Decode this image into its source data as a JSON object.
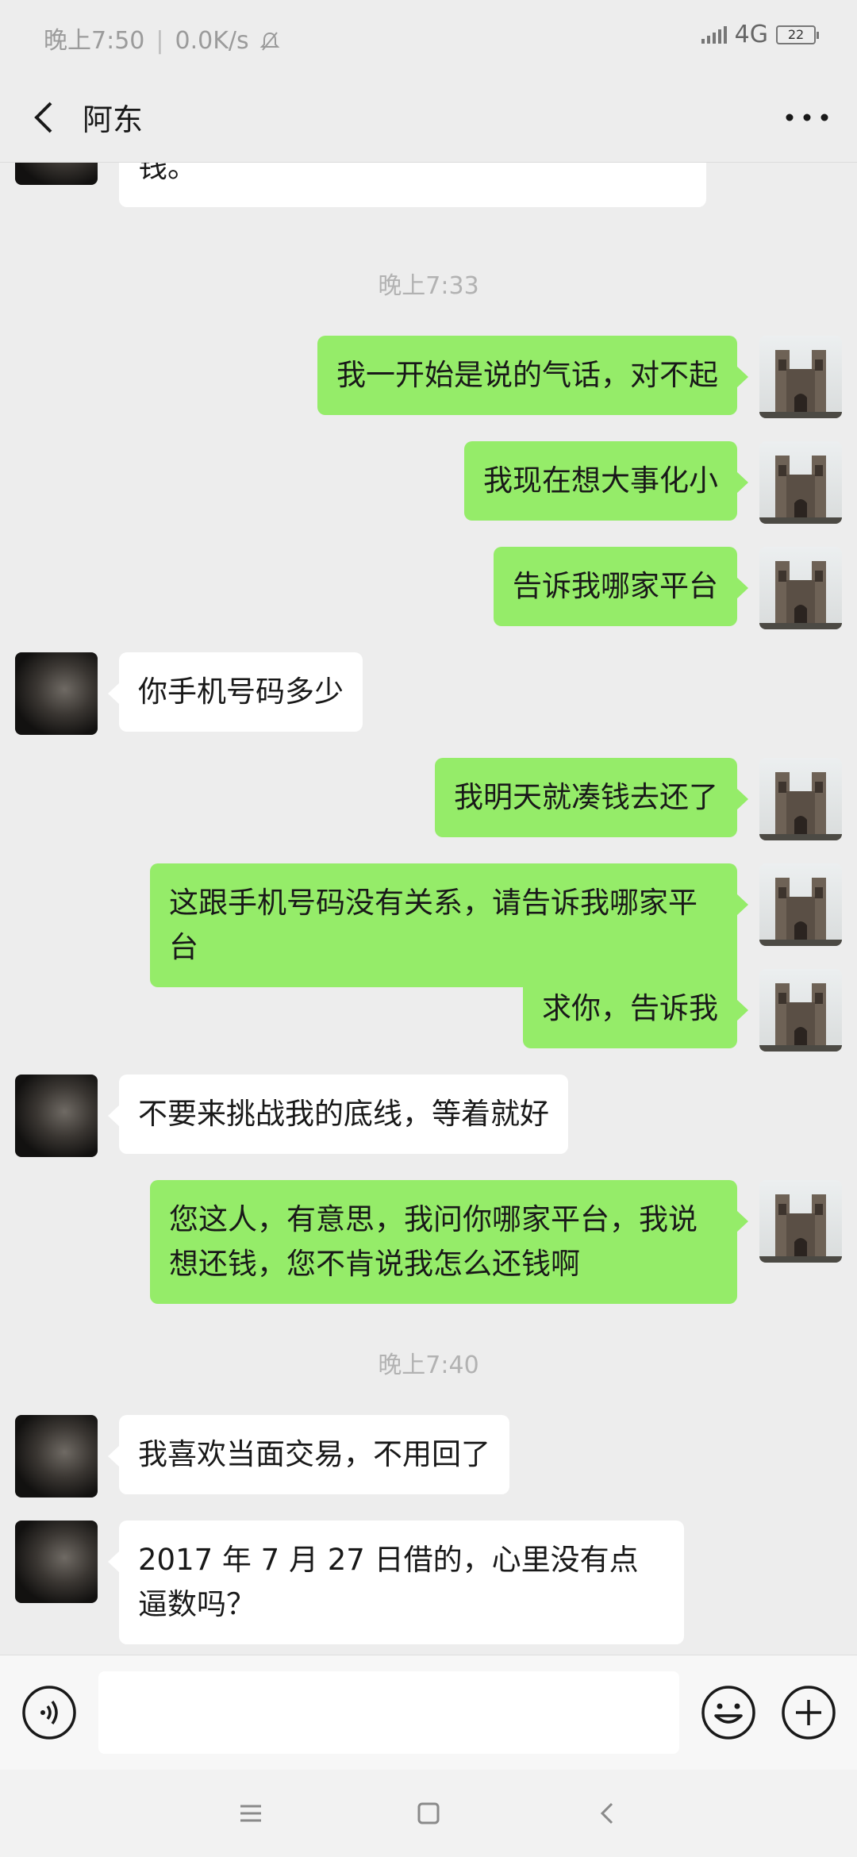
{
  "status": {
    "time": "晚上7:50",
    "speed": "0.0K/s",
    "network": "4G",
    "battery": "22"
  },
  "header": {
    "title": "阿东"
  },
  "messages": {
    "m0": "钱。",
    "t1": "晚上7:33",
    "m1": "我一开始是说的气话，对不起",
    "m2": "我现在想大事化小",
    "m3": "告诉我哪家平台",
    "m4": "你手机号码多少",
    "m5": "我明天就凑钱去还了",
    "m6": "这跟手机号码没有关系，请告诉我哪家平台",
    "m7": "求你，告诉我",
    "m8": "不要来挑战我的底线，等着就好",
    "m9": "您这人，有意思，我问你哪家平台，我说想还钱，您不肯说我怎么还钱啊",
    "t2": "晚上7:40",
    "m10": "我喜欢当面交易，不用回了",
    "m11": "2017 年 7 月 27 日借的，心里没有点逼数吗？"
  },
  "input": {
    "value": "",
    "placeholder": ""
  },
  "colors": {
    "sent_bubble": "#95ec69",
    "received_bubble": "#ffffff",
    "background": "#ededed"
  },
  "icons": {
    "back": "chevron-left-icon",
    "more": "more-dots-icon",
    "voice": "voice-icon",
    "emoji": "emoji-icon",
    "plus": "plus-icon",
    "nav_menu": "menu-icon",
    "nav_home": "home-icon",
    "nav_back": "back-icon"
  }
}
